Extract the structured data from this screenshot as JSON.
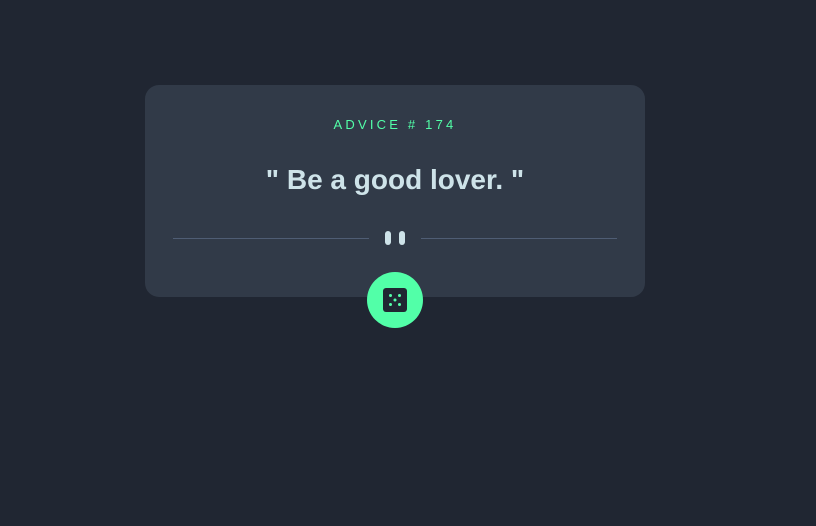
{
  "card": {
    "advice_id": "ADVICE # 174",
    "quote": "\" Be a good lover. \""
  },
  "icons": {
    "divider": "pause-icon",
    "button": "dice-icon"
  },
  "colors": {
    "background": "#202632",
    "card": "#313a48",
    "accent": "#52ffa8",
    "text": "#cee3e9",
    "divider": "#4f5d74"
  }
}
